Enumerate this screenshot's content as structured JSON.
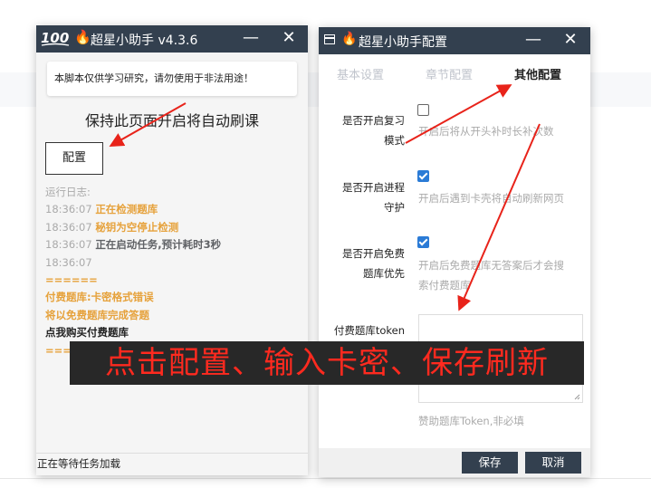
{
  "left_window": {
    "title": "超星小助手 v4.3.6",
    "logo_text": "100",
    "notice": "本脚本仅供学习研究，请勿使用于非法用途！",
    "keep_text": "保持此页面开启将自动刷课",
    "config_button": "配置",
    "log": [
      {
        "time": "",
        "text": "运行日志:",
        "style": "gray"
      },
      {
        "time": "18:36:07",
        "text": "正在检测题库",
        "style": "orange b"
      },
      {
        "time": "18:36:07",
        "text": "秘钥为空停止检测",
        "style": "orange b"
      },
      {
        "time": "18:36:07",
        "text": "正在启动任务,预计耗时3秒",
        "style": "dark b"
      },
      {
        "time": "18:36:07",
        "text": "",
        "style": "gray"
      },
      {
        "time": "",
        "text": "======",
        "style": "orange b"
      },
      {
        "time": "",
        "text": "付费题库:卡密格式错误",
        "style": "orange b"
      },
      {
        "time": "",
        "text": "将以免费题库完成答题",
        "style": "orange b"
      },
      {
        "time": "",
        "text": "点我购买付费题库",
        "style": "black b"
      },
      {
        "time": "",
        "text": "======",
        "style": "orange b"
      }
    ],
    "status": "正在等待任务加载"
  },
  "right_window": {
    "title": "超星小助手配置",
    "tabs": [
      "基本设置",
      "章节配置",
      "其他配置"
    ],
    "fields": [
      {
        "label1": "是否开启复习",
        "label2": "模式",
        "checked": false,
        "hint1": "开启后将从开头补时长补次数",
        "hint2": ""
      },
      {
        "label1": "是否开启进程",
        "label2": "守护",
        "checked": true,
        "hint1": "开启后遇到卡壳将自动刷新网页",
        "hint2": ""
      },
      {
        "label1": "是否开启免费",
        "label2": "题库优先",
        "checked": true,
        "hint1": "开启后免费题库无答案后才会搜",
        "hint2": "索付费题库"
      }
    ],
    "token_label": "付费题库token",
    "token_hint": "赞助题库Token,非必填",
    "save_button": "保存",
    "cancel_button": "取消"
  },
  "banner": "点击配置、输入卡密、保存刷新",
  "colors": {
    "titlebar": "#33404f",
    "accent_orange": "#e6a23c",
    "arrow_red": "#e8231a",
    "banner_text": "#ff2a1f"
  }
}
